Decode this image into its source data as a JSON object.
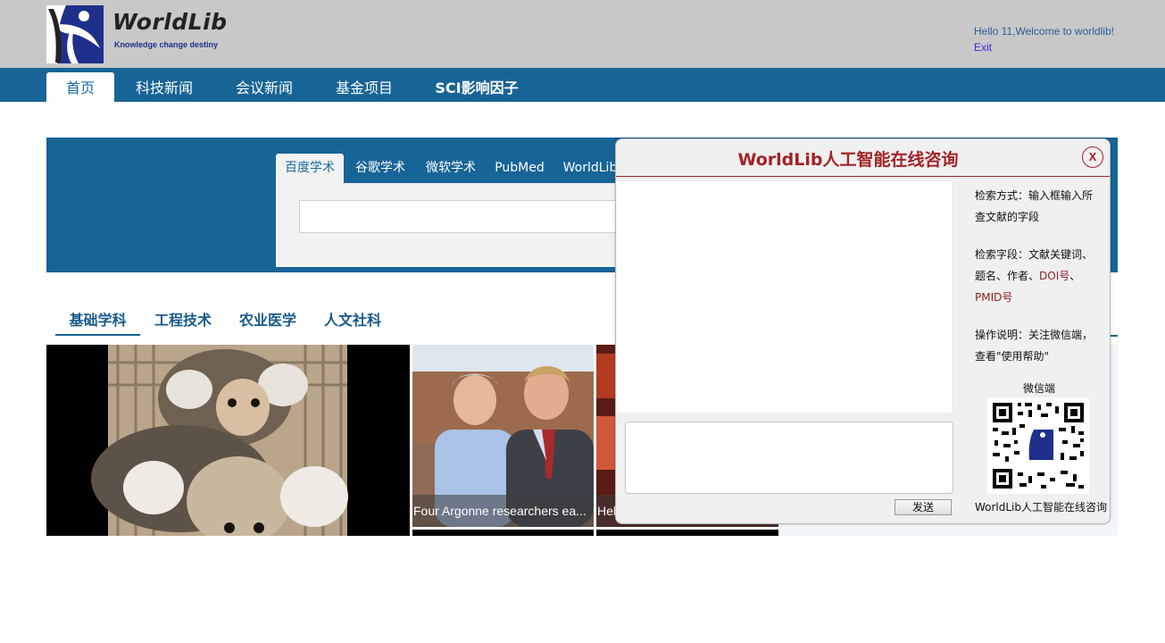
{
  "header": {
    "logo_name": "WorldLib",
    "logo_tagline": "Knowledge change destiny",
    "greeting": "Hello 11,Welcome to worldlib!",
    "exit_label": "Exit"
  },
  "nav": {
    "items": [
      {
        "label": "首页"
      },
      {
        "label": "科技新闻"
      },
      {
        "label": "会议新闻"
      },
      {
        "label": "基金项目"
      },
      {
        "label": "SCI影响因子"
      }
    ]
  },
  "search": {
    "tabs": [
      {
        "label": "百度学术"
      },
      {
        "label": "谷歌学术"
      },
      {
        "label": "微软学术"
      },
      {
        "label": "PubMed"
      },
      {
        "label": "WorldLib"
      }
    ],
    "input_value": ""
  },
  "categories": {
    "tabs": [
      {
        "label": "基础学科"
      },
      {
        "label": "工程技术"
      },
      {
        "label": "农业医学"
      },
      {
        "label": "人文社科"
      }
    ]
  },
  "news": {
    "cards": [
      {
        "caption": ""
      },
      {
        "caption": "Four Argonne researchers ea..."
      },
      {
        "caption": "Hel"
      }
    ]
  },
  "chat": {
    "title": "WorldLib人工智能在线咨询",
    "close_label": "X",
    "send_label": "发送",
    "help": {
      "search_method_1": "检索方式：输入框输入所",
      "search_method_2": "查文献的字段",
      "search_fields_1": "检索字段：文献关键词、",
      "search_fields_2": "题名、作者、",
      "search_fields_doi": "DOI号",
      "search_fields_3": "、",
      "search_fields_pmid": "PMID号",
      "operation_1": "操作说明：关注微信端，",
      "operation_2": "查看\"使用帮助\""
    },
    "wechat_label": "微信端",
    "qr_caption": "WorldLib人工智能在线咨询"
  },
  "colors": {
    "header_bg": "#c8c8c8",
    "nav_bg": "#176496",
    "chat_title": "#a32226"
  }
}
